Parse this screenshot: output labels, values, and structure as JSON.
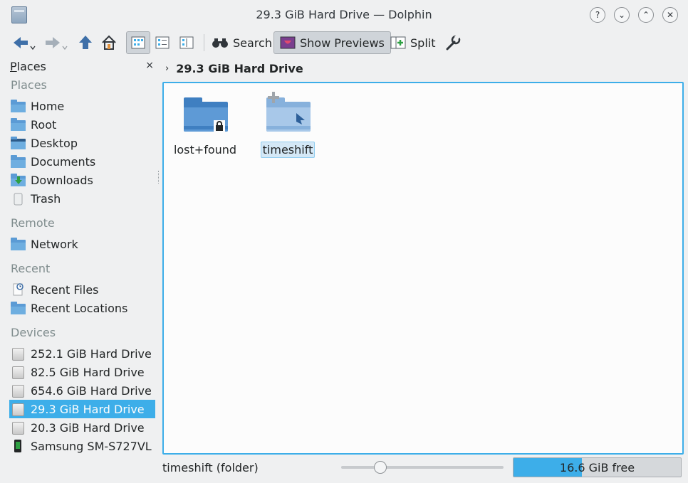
{
  "window": {
    "title": "29.3 GiB Hard Drive — Dolphin",
    "buttons": [
      "?",
      "⌄",
      "⌃",
      "✕"
    ]
  },
  "toolbar": {
    "search_label": "Search",
    "previews_label": "Show Previews",
    "split_label": "Split"
  },
  "places": {
    "header_first": "P",
    "header_rest": "laces",
    "close": "×",
    "sections": {
      "places": "Places",
      "remote": "Remote",
      "recent": "Recent",
      "devices": "Devices"
    },
    "places_items": [
      {
        "label": "Home",
        "icon": "home-folder-icon"
      },
      {
        "label": "Root",
        "icon": "folder-icon"
      },
      {
        "label": "Desktop",
        "icon": "desktop-icon"
      },
      {
        "label": "Documents",
        "icon": "documents-folder-icon"
      },
      {
        "label": "Downloads",
        "icon": "downloads-folder-icon"
      },
      {
        "label": "Trash",
        "icon": "trash-icon"
      }
    ],
    "remote_items": [
      {
        "label": "Network",
        "icon": "network-folder-icon"
      }
    ],
    "recent_items": [
      {
        "label": "Recent Files",
        "icon": "recent-files-icon"
      },
      {
        "label": "Recent Locations",
        "icon": "recent-locations-icon"
      }
    ],
    "devices_items": [
      {
        "label": "252.1 GiB Hard Drive",
        "icon": "hard-drive-icon"
      },
      {
        "label": "82.5 GiB Hard Drive",
        "icon": "hard-drive-icon"
      },
      {
        "label": "654.6 GiB Hard Drive",
        "icon": "hard-drive-icon"
      },
      {
        "label": "29.3 GiB Hard Drive",
        "icon": "hard-drive-icon",
        "selected": true
      },
      {
        "label": "20.3 GiB Hard Drive",
        "icon": "hard-drive-icon"
      },
      {
        "label": "Samsung SM-S727VL",
        "icon": "phone-icon"
      }
    ]
  },
  "breadcrumb": {
    "chevron": "›",
    "current": "29.3 GiB Hard Drive"
  },
  "files": [
    {
      "name": "lost+found",
      "type": "locked-folder",
      "selected": false
    },
    {
      "name": "timeshift",
      "type": "folder",
      "selected": true
    }
  ],
  "statusbar": {
    "text": "timeshift (folder)",
    "free_space": "16.6 GiB free",
    "used_fraction": 0.41,
    "zoom_level": 0.24
  },
  "colors": {
    "accent": "#3daee9",
    "folder": "#5e9ad6"
  }
}
